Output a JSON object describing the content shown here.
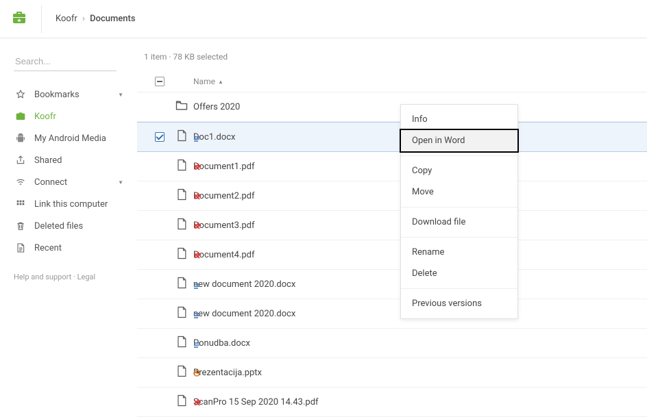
{
  "breadcrumb": {
    "root": "Koofr",
    "current": "Documents"
  },
  "search": {
    "placeholder": "Search..."
  },
  "sidebar": {
    "items": [
      {
        "name": "bookmarks",
        "label": "Bookmarks",
        "caret": true,
        "icon": "star"
      },
      {
        "name": "koofr",
        "label": "Koofr",
        "active": true,
        "icon": "briefcase"
      },
      {
        "name": "android",
        "label": "My Android Media",
        "icon": "android"
      },
      {
        "name": "shared",
        "label": "Shared",
        "icon": "share"
      },
      {
        "name": "connect",
        "label": "Connect",
        "caret": true,
        "icon": "wifi"
      },
      {
        "name": "link",
        "label": "Link this computer",
        "icon": "grid"
      },
      {
        "name": "deleted",
        "label": "Deleted files",
        "icon": "trash"
      },
      {
        "name": "recent",
        "label": "Recent",
        "icon": "recent"
      }
    ]
  },
  "footer": {
    "help": "Help and support",
    "sep": " · ",
    "legal": "Legal"
  },
  "status": "1 item · 78 KB selected",
  "list": {
    "sort_label": "Name",
    "rows": [
      {
        "type": "folder",
        "name": "Offers 2020"
      },
      {
        "type": "docx",
        "name": "Doc1.docx",
        "selected": true
      },
      {
        "type": "pdf",
        "name": "Document1.pdf"
      },
      {
        "type": "pdf",
        "name": "Document2.pdf"
      },
      {
        "type": "pdf",
        "name": "Document3.pdf"
      },
      {
        "type": "pdf",
        "name": "Document4.pdf"
      },
      {
        "type": "docx",
        "name": "new document 2020.docx"
      },
      {
        "type": "docx",
        "name": "new document 2020.docx"
      },
      {
        "type": "docx",
        "name": "Ponudba.docx"
      },
      {
        "type": "pptx",
        "name": "Prezentacija.pptx"
      },
      {
        "type": "pdf",
        "name": "ScanPro 15 Sep 2020 14.43.pdf"
      }
    ]
  },
  "context_menu": {
    "groups": [
      [
        {
          "id": "info",
          "label": "Info"
        },
        {
          "id": "open-word",
          "label": "Open in Word",
          "highlight": true
        }
      ],
      [
        {
          "id": "copy",
          "label": "Copy"
        },
        {
          "id": "move",
          "label": "Move"
        }
      ],
      [
        {
          "id": "download",
          "label": "Download file"
        }
      ],
      [
        {
          "id": "rename",
          "label": "Rename"
        },
        {
          "id": "delete",
          "label": "Delete"
        }
      ],
      [
        {
          "id": "versions",
          "label": "Previous versions"
        }
      ]
    ]
  }
}
